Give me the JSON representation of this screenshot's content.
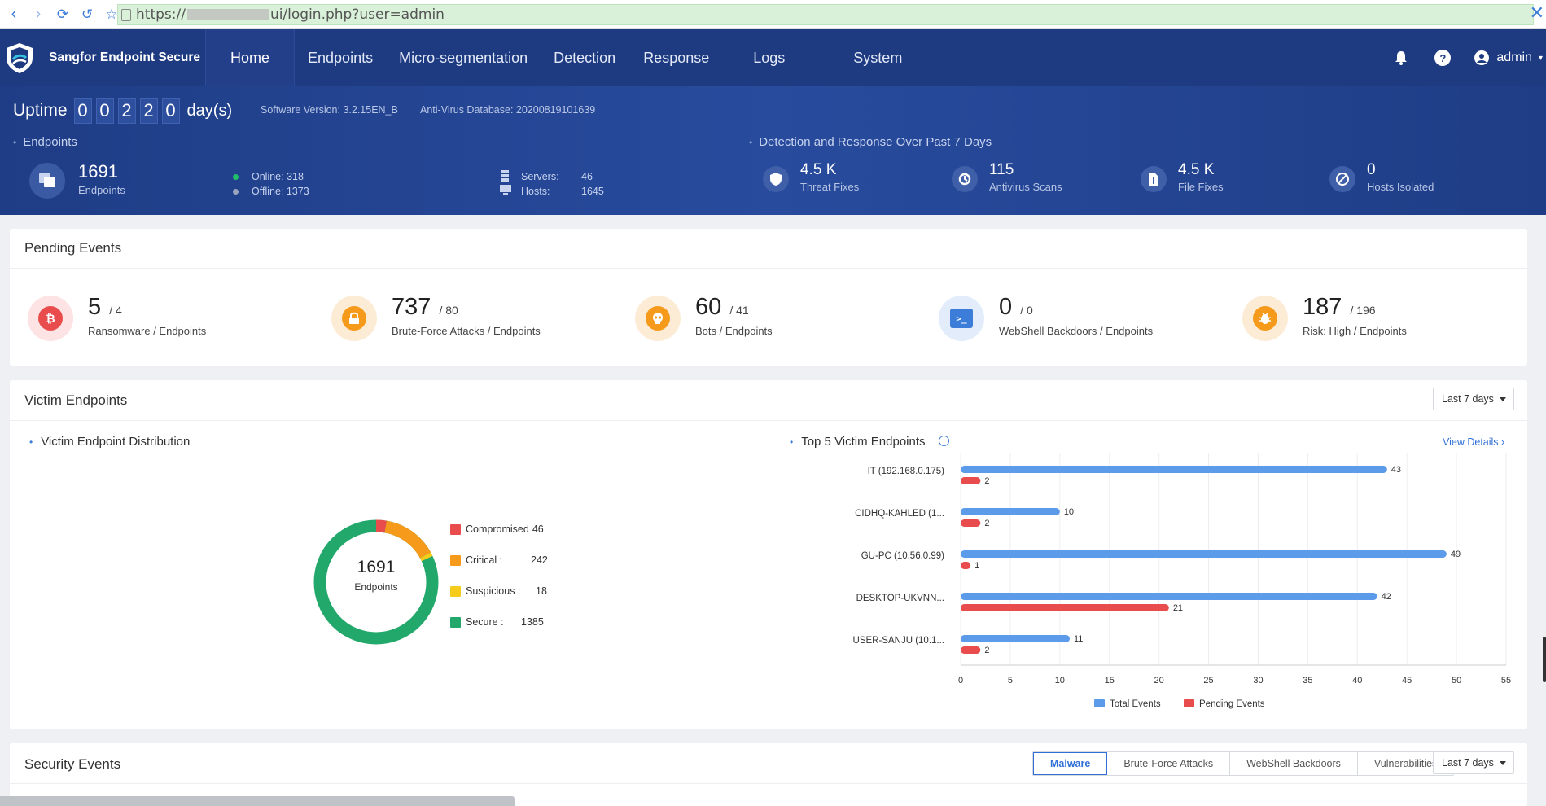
{
  "browser": {
    "url_prefix": "https://",
    "url_suffix": "ui/login.php?user=admin"
  },
  "app": {
    "title": "Sangfor Endpoint Secure",
    "nav": [
      "Home",
      "Endpoints",
      "Micro-segmentation",
      "Detection",
      "Response",
      "Logs",
      "System"
    ],
    "user": "admin"
  },
  "banner": {
    "uptime_label": "Uptime",
    "uptime_digits": [
      "0",
      "0",
      "2",
      "2",
      "0"
    ],
    "uptime_unit": "day(s)",
    "software_version": "Software Version: 3.2.15EN_B",
    "av_database": "Anti-Virus Database: 20200819101639",
    "endpoints_label": "Endpoints",
    "endpoints_total": "1691",
    "endpoints_sub": "Endpoints",
    "online": "Online: 318",
    "offline": "Offline: 1373",
    "servers_label": "Servers:",
    "servers_value": "46",
    "hosts_label": "Hosts:",
    "hosts_value": "1645",
    "detection_label": "Detection and Response Over Past 7 Days",
    "stats": [
      {
        "value": "4.5 K",
        "label": "Threat Fixes"
      },
      {
        "value": "115",
        "label": "Antivirus Scans"
      },
      {
        "value": "4.5 K",
        "label": "File Fixes"
      },
      {
        "value": "0",
        "label": "Hosts Isolated"
      }
    ]
  },
  "pending": {
    "title": "Pending Events",
    "items": [
      {
        "value": "5",
        "total": "/ 4",
        "label": "Ransomware / Endpoints",
        "icon": "bitcoin-icon"
      },
      {
        "value": "737",
        "total": "/ 80",
        "label": "Brute-Force Attacks / Endpoints",
        "icon": "lock-icon"
      },
      {
        "value": "60",
        "total": "/ 41",
        "label": "Bots / Endpoints",
        "icon": "skull-icon"
      },
      {
        "value": "0",
        "total": "/ 0",
        "label": "WebShell Backdoors / Endpoints",
        "icon": "terminal-icon"
      },
      {
        "value": "187",
        "total": "/ 196",
        "label": "Risk: High / Endpoints",
        "icon": "bug-icon"
      }
    ]
  },
  "victim": {
    "title": "Victim Endpoints",
    "range": "Last 7 days",
    "dist_title": "Victim Endpoint Distribution",
    "donut_total": "1691",
    "donut_label": "Endpoints",
    "top_title": "Top 5 Victim Endpoints",
    "view_details": "View Details",
    "legend": [
      {
        "label": "Compromised",
        "value": "46",
        "color": "#e84c4c"
      },
      {
        "label": "Critical :",
        "value": "242",
        "color": "#f59a1b"
      },
      {
        "label": "Suspicious :",
        "value": "18",
        "color": "#f5cc1b"
      },
      {
        "label": "Secure :",
        "value": "1385",
        "color": "#22a86b"
      }
    ]
  },
  "chart_data": {
    "type": "bar",
    "orientation": "horizontal",
    "categories": [
      "IT (192.168.0.175)",
      "CIDHQ-KAHLED (1...",
      "GU-PC (10.56.0.99)",
      "DESKTOP-UKVNN...",
      "USER-SANJU (10.1..."
    ],
    "series": [
      {
        "name": "Total Events",
        "values": [
          43,
          10,
          49,
          42,
          11
        ],
        "color": "#5b9bea"
      },
      {
        "name": "Pending Events",
        "values": [
          2,
          2,
          1,
          21,
          2
        ],
        "color": "#e84c4c"
      }
    ],
    "x_ticks": [
      0,
      5,
      10,
      15,
      20,
      25,
      30,
      35,
      40,
      45,
      50,
      55
    ],
    "xlim": [
      0,
      55
    ],
    "grid": true,
    "legend_placement": "bottom"
  },
  "security": {
    "title": "Security Events",
    "tabs": [
      "Malware",
      "Brute-Force Attacks",
      "WebShell Backdoors",
      "Vulnerabilities"
    ],
    "range": "Last 7 days"
  }
}
